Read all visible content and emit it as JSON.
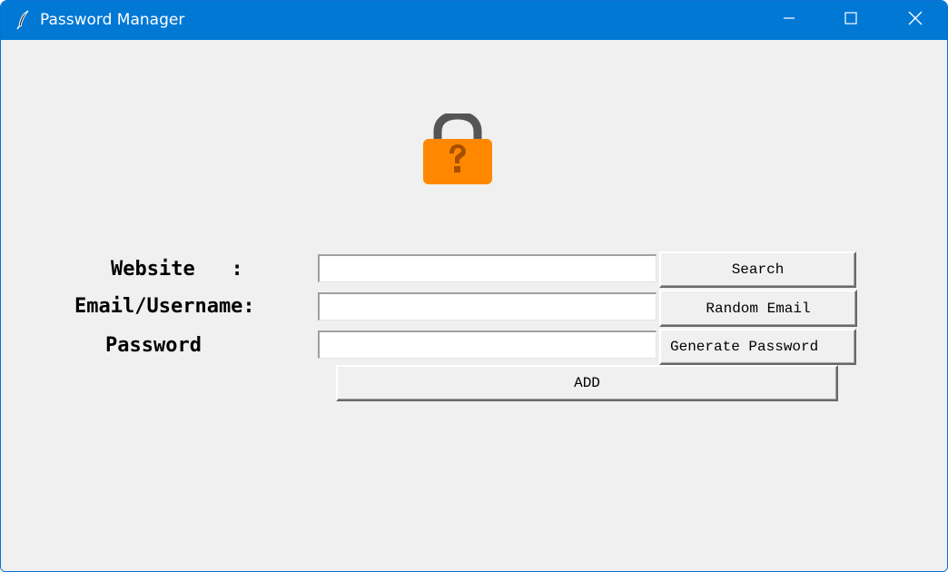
{
  "window": {
    "title": "Password Manager",
    "accent_color": "#0078d4",
    "icon": "feather-icon"
  },
  "titlebar_buttons": {
    "minimize_icon": "minimize-icon",
    "maximize_icon": "maximize-icon",
    "close_icon": "close-icon"
  },
  "logo": {
    "icon": "padlock-question-icon",
    "body_color": "#ff8800",
    "shackle_color": "#555555"
  },
  "form": {
    "website_label": "Website   :",
    "email_label": "Email/Username:",
    "password_label": "Password",
    "website_value": "",
    "email_value": "",
    "password_value": ""
  },
  "buttons": {
    "search": "Search",
    "random_email": "Random Email",
    "generate_password": "Generate Password",
    "add": "ADD"
  }
}
